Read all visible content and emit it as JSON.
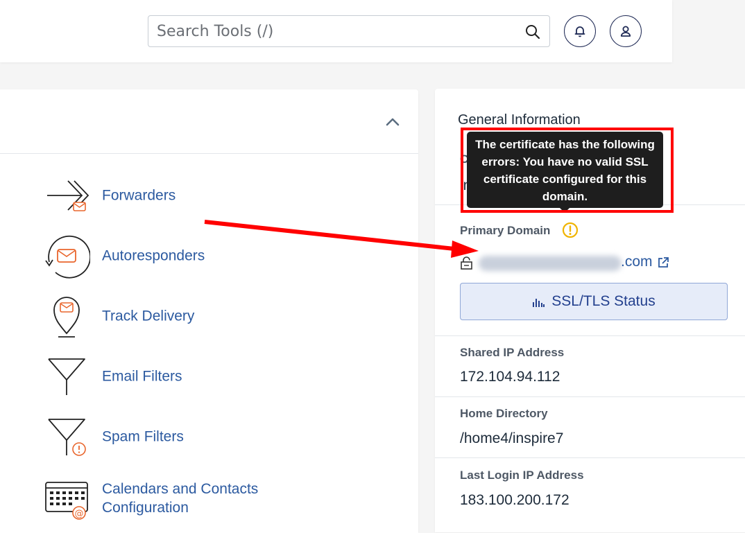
{
  "header": {
    "search_placeholder": "Search Tools (/)",
    "search_icon": "search-icon",
    "notifications_icon": "bell-icon",
    "user_icon": "user-icon"
  },
  "email_section": {
    "collapse_icon": "chevron-up-icon",
    "tools": [
      {
        "label": "Forwarders",
        "icon": "forwarders-icon"
      },
      {
        "label": "Autoresponders",
        "icon": "autoresponders-icon"
      },
      {
        "label": "Track Delivery",
        "icon": "track-delivery-icon"
      },
      {
        "label": "Email Filters",
        "icon": "email-filters-icon"
      },
      {
        "label": "Spam Filters",
        "icon": "spam-filters-icon"
      },
      {
        "label": "Calendars and Contacts Configuration",
        "icon": "calendar-icon"
      }
    ]
  },
  "general_info": {
    "title": "General Information",
    "current_user_partial_label": "Cu",
    "current_user_partial_value": "inspire",
    "primary_domain_label": "Primary Domain",
    "primary_domain_suffix": ".com",
    "ssl_button_label": "SSL/TLS Status",
    "shared_ip_label": "Shared IP Address",
    "shared_ip_value": "172.104.94.112",
    "home_dir_label": "Home Directory",
    "home_dir_value": "/home4/inspire7",
    "last_login_label": "Last Login IP Address",
    "last_login_value": "183.100.200.172"
  },
  "tooltip": {
    "text": "The certificate has the following errors: You have no valid SSL certificate configured for this domain."
  },
  "colors": {
    "link_blue": "#2c5aa0",
    "accent_orange": "#e9662d",
    "warning_yellow": "#f0b400",
    "annotation_red": "#ff0000"
  }
}
